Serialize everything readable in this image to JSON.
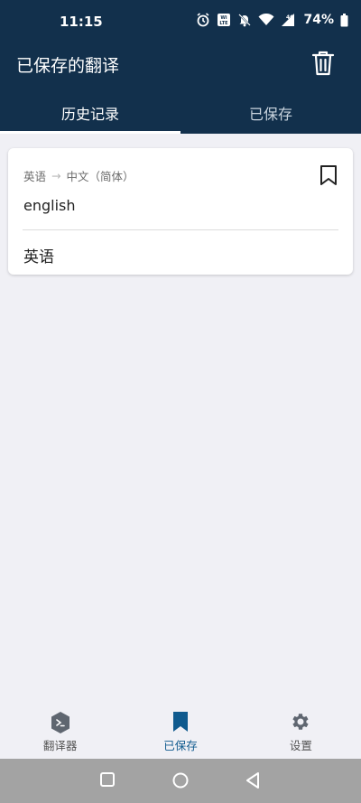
{
  "status_bar": {
    "time": "11:15",
    "battery": "74%",
    "network": "4G"
  },
  "app_bar": {
    "title": "已保存的翻译"
  },
  "tabs": [
    {
      "label": "历史记录",
      "active": true
    },
    {
      "label": "已保存",
      "active": false
    }
  ],
  "card": {
    "source_lang": "英语",
    "target_lang": "中文（简体）",
    "arrow": "→",
    "source_text": "english",
    "target_text": "英语"
  },
  "bottom_nav": [
    {
      "label": "翻译器",
      "icon": "translator-icon",
      "active": false
    },
    {
      "label": "已保存",
      "icon": "bookmark-icon",
      "active": true
    },
    {
      "label": "设置",
      "icon": "gear-icon",
      "active": false
    }
  ],
  "colors": {
    "header": "#12304c",
    "accent": "#0f5a8e",
    "background": "#f0f0f5"
  }
}
